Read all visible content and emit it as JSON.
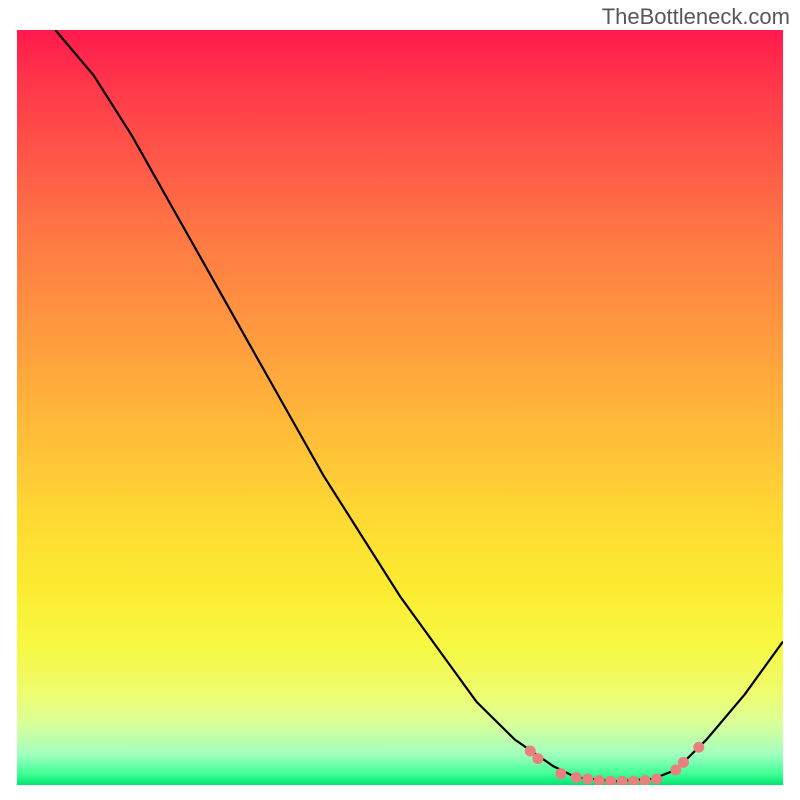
{
  "attribution": "TheBottleneck.com",
  "chart_data": {
    "type": "line",
    "title": "",
    "xlabel": "",
    "ylabel": "",
    "xlim": [
      0,
      100
    ],
    "ylim": [
      0,
      100
    ],
    "curve": {
      "comment": "Approximate bottleneck percentage curve; minimum near x~75-85",
      "points": [
        {
          "x": 5,
          "y": 100
        },
        {
          "x": 10,
          "y": 94
        },
        {
          "x": 15,
          "y": 86
        },
        {
          "x": 20,
          "y": 77
        },
        {
          "x": 25,
          "y": 68
        },
        {
          "x": 30,
          "y": 59
        },
        {
          "x": 35,
          "y": 50
        },
        {
          "x": 40,
          "y": 41
        },
        {
          "x": 45,
          "y": 33
        },
        {
          "x": 50,
          "y": 25
        },
        {
          "x": 55,
          "y": 18
        },
        {
          "x": 60,
          "y": 11
        },
        {
          "x": 65,
          "y": 6
        },
        {
          "x": 70,
          "y": 2.5
        },
        {
          "x": 73,
          "y": 1
        },
        {
          "x": 78,
          "y": 0.5
        },
        {
          "x": 83,
          "y": 0.8
        },
        {
          "x": 86,
          "y": 2
        },
        {
          "x": 90,
          "y": 6
        },
        {
          "x": 95,
          "y": 12
        },
        {
          "x": 100,
          "y": 19
        }
      ]
    },
    "markers": {
      "comment": "Salmon-colored dots near the curve minimum",
      "color": "#e88080",
      "points": [
        {
          "x": 67,
          "y": 4.5
        },
        {
          "x": 68,
          "y": 3.5
        },
        {
          "x": 71,
          "y": 1.5
        },
        {
          "x": 73,
          "y": 1
        },
        {
          "x": 74.5,
          "y": 0.8
        },
        {
          "x": 76,
          "y": 0.6
        },
        {
          "x": 77.5,
          "y": 0.5
        },
        {
          "x": 79,
          "y": 0.5
        },
        {
          "x": 80.5,
          "y": 0.5
        },
        {
          "x": 82,
          "y": 0.6
        },
        {
          "x": 83.5,
          "y": 0.8
        },
        {
          "x": 86,
          "y": 2
        },
        {
          "x": 87,
          "y": 3
        },
        {
          "x": 89,
          "y": 5
        }
      ]
    }
  }
}
